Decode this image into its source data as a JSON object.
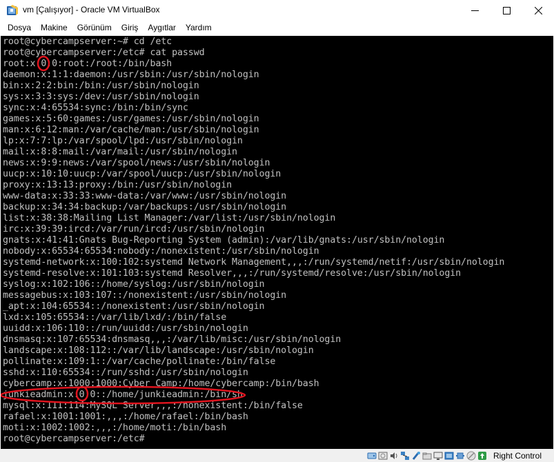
{
  "window": {
    "title": "vm [Çalışıyor] - Oracle VM VirtualBox",
    "minimize_symbol": "─",
    "maximize_symbol": "☐",
    "close_symbol": "✕"
  },
  "menu": {
    "items": [
      {
        "label": "Dosya"
      },
      {
        "label": "Makine"
      },
      {
        "label": "Görünüm"
      },
      {
        "label": "Giriş"
      },
      {
        "label": "Aygıtlar"
      },
      {
        "label": "Yardım"
      }
    ]
  },
  "terminal": {
    "lines": [
      "root@cybercampserver:~# cd /etc",
      "root@cybercampserver:/etc# cat passwd",
      "root:x:0:0:root:/root:/bin/bash",
      "daemon:x:1:1:daemon:/usr/sbin:/usr/sbin/nologin",
      "bin:x:2:2:bin:/bin:/usr/sbin/nologin",
      "sys:x:3:3:sys:/dev:/usr/sbin/nologin",
      "sync:x:4:65534:sync:/bin:/bin/sync",
      "games:x:5:60:games:/usr/games:/usr/sbin/nologin",
      "man:x:6:12:man:/var/cache/man:/usr/sbin/nologin",
      "lp:x:7:7:lp:/var/spool/lpd:/usr/sbin/nologin",
      "mail:x:8:8:mail:/var/mail:/usr/sbin/nologin",
      "news:x:9:9:news:/var/spool/news:/usr/sbin/nologin",
      "uucp:x:10:10:uucp:/var/spool/uucp:/usr/sbin/nologin",
      "proxy:x:13:13:proxy:/bin:/usr/sbin/nologin",
      "www-data:x:33:33:www-data:/var/www:/usr/sbin/nologin",
      "backup:x:34:34:backup:/var/backups:/usr/sbin/nologin",
      "list:x:38:38:Mailing List Manager:/var/list:/usr/sbin/nologin",
      "irc:x:39:39:ircd:/var/run/ircd:/usr/sbin/nologin",
      "gnats:x:41:41:Gnats Bug-Reporting System (admin):/var/lib/gnats:/usr/sbin/nologin",
      "nobody:x:65534:65534:nobody:/nonexistent:/usr/sbin/nologin",
      "systemd-network:x:100:102:systemd Network Management,,,:/run/systemd/netif:/usr/sbin/nologin",
      "systemd-resolve:x:101:103:systemd Resolver,,,:/run/systemd/resolve:/usr/sbin/nologin",
      "syslog:x:102:106::/home/syslog:/usr/sbin/nologin",
      "messagebus:x:103:107::/nonexistent:/usr/sbin/nologin",
      "_apt:x:104:65534::/nonexistent:/usr/sbin/nologin",
      "lxd:x:105:65534::/var/lib/lxd/:/bin/false",
      "uuidd:x:106:110::/run/uuidd:/usr/sbin/nologin",
      "dnsmasq:x:107:65534:dnsmasq,,,:/var/lib/misc:/usr/sbin/nologin",
      "landscape:x:108:112::/var/lib/landscape:/usr/sbin/nologin",
      "pollinate:x:109:1::/var/cache/pollinate:/bin/false",
      "sshd:x:110:65534::/run/sshd:/usr/sbin/nologin",
      "cybercamp:x:1000:1000:Cyber Camp:/home/cybercamp:/bin/bash",
      "junkieadmin:x:0:0::/home/junkieadmin:/bin/sh",
      "mysql:x:111:114:MySQL Server,,,:/nonexistent:/bin/false",
      "rafael:x:1001:1001:,,,:/home/rafael:/bin/bash",
      "moti:x:1002:1002:,,,:/home/moti:/bin/bash",
      "root@cybercampserver:/etc#"
    ],
    "text_color": "#c0c0c0",
    "background": "#000000",
    "annotation_color": "#e0141e"
  },
  "statusbar": {
    "icons": [
      "hard-disk-icon",
      "optical-drive-icon",
      "audio-icon",
      "network-icon",
      "usb-icon",
      "shared-folders-icon",
      "display-icon",
      "video-capture-icon",
      "cpu-icon",
      "mouse-integration-icon",
      "keyboard-arrow-icon"
    ],
    "host_key": "Right Control"
  }
}
